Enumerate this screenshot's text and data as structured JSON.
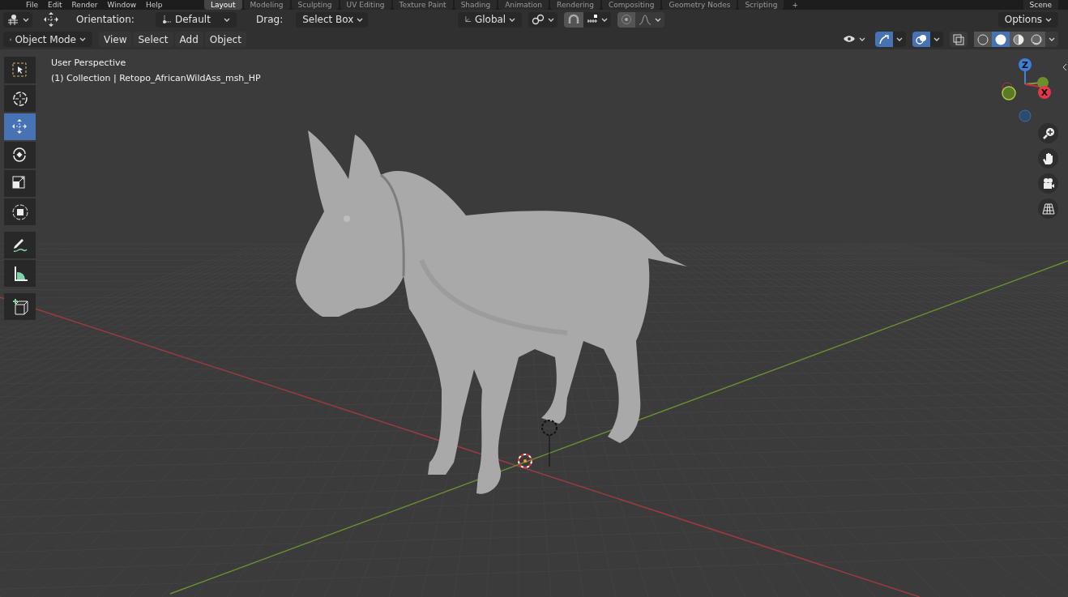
{
  "menu": [
    "File",
    "Edit",
    "Render",
    "Window",
    "Help"
  ],
  "workspaces": [
    {
      "label": "Layout",
      "selected": true
    },
    {
      "label": "Modeling",
      "selected": false
    },
    {
      "label": "Sculpting",
      "selected": false
    },
    {
      "label": "UV Editing",
      "selected": false
    },
    {
      "label": "Texture Paint",
      "selected": false
    },
    {
      "label": "Shading",
      "selected": false
    },
    {
      "label": "Animation",
      "selected": false
    },
    {
      "label": "Rendering",
      "selected": false
    },
    {
      "label": "Compositing",
      "selected": false
    },
    {
      "label": "Geometry Nodes",
      "selected": false
    },
    {
      "label": "Scripting",
      "selected": false
    }
  ],
  "add_workspace": "+",
  "scene": "Scene",
  "tool_settings": {
    "orientation_label": "Orientation:",
    "orientation": "Default",
    "drag_label": "Drag:",
    "drag": "Select Box",
    "transform_orientation": "Global",
    "options": "Options"
  },
  "header": {
    "mode": "Object Mode",
    "menus": [
      "View",
      "Select",
      "Add",
      "Object"
    ]
  },
  "shading_modes": [
    {
      "selected": false
    },
    {
      "selected": true
    },
    {
      "selected": false
    },
    {
      "selected": false
    }
  ],
  "tools": [
    {
      "selected": false
    },
    {
      "selected": false
    },
    {
      "selected": true
    },
    {
      "selected": false
    },
    {
      "selected": false
    },
    {
      "selected": false
    },
    {
      "selected": false
    },
    {
      "selected": false
    },
    {
      "selected": false
    }
  ],
  "overlay_text": [
    "User Perspective",
    "(1) Collection | Retopo_AfricanWildAss_msh_HP"
  ],
  "gizmo": {
    "z": "Z",
    "x": "X"
  }
}
